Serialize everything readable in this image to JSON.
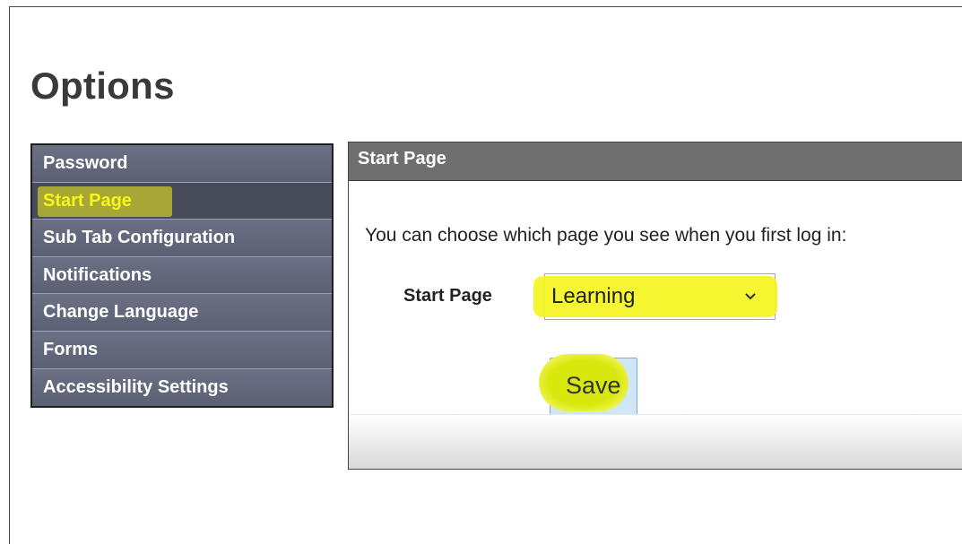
{
  "page": {
    "title": "Options"
  },
  "sidebar": {
    "items": [
      {
        "label": "Password"
      },
      {
        "label": "Start Page",
        "active": true
      },
      {
        "label": "Sub Tab Configuration"
      },
      {
        "label": "Notifications"
      },
      {
        "label": "Change Language"
      },
      {
        "label": "Forms"
      },
      {
        "label": "Accessibility Settings"
      }
    ]
  },
  "panel": {
    "header": "Start Page",
    "description": "You can choose which page you see when you first log in:",
    "field_label": "Start Page",
    "select_value": "Learning",
    "save_label": "Save"
  },
  "colors": {
    "highlight": "#f4f41a",
    "sidebar_bg": "#5f6477",
    "panel_header_bg": "#6f6f6f",
    "save_button_bg": "#cfe6f8"
  }
}
